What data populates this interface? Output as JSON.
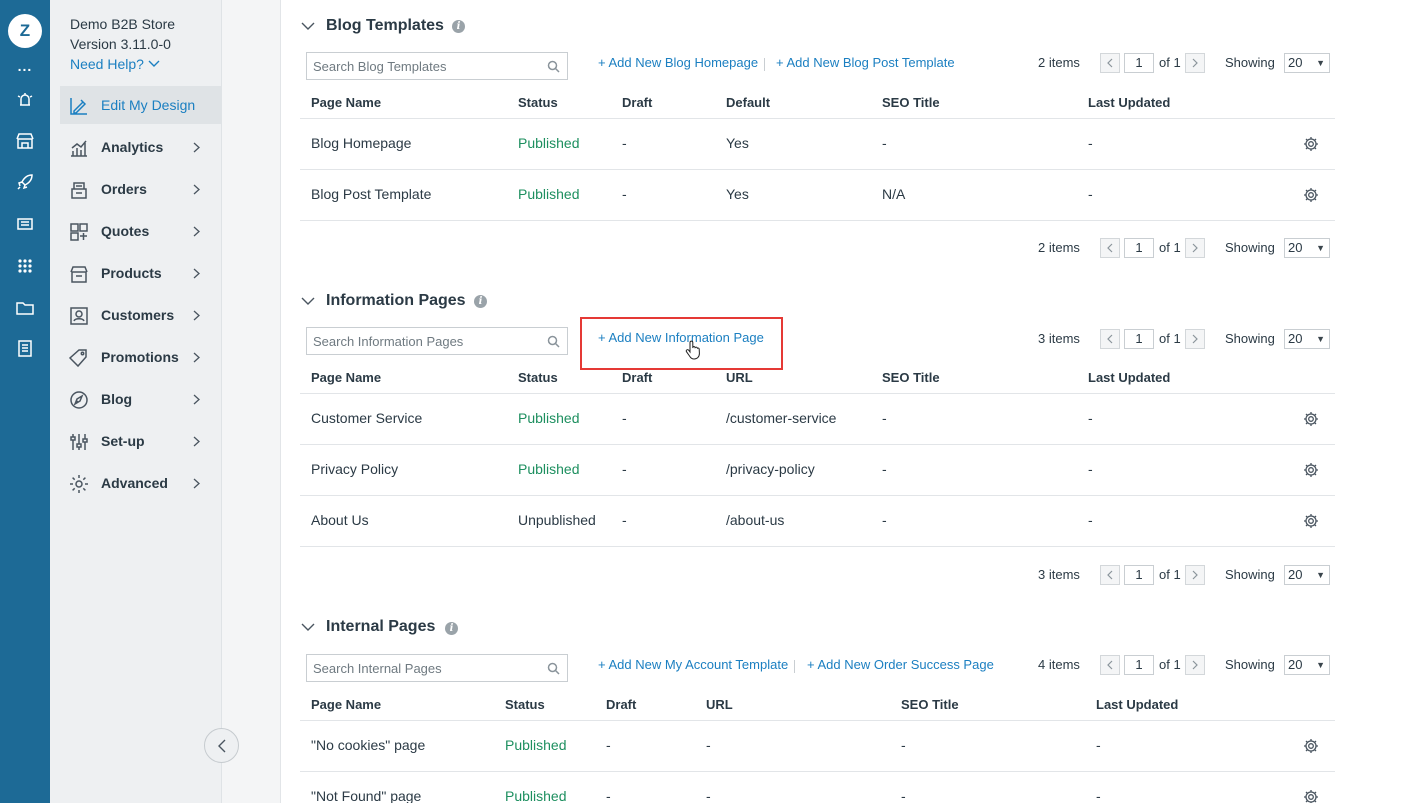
{
  "brand": {
    "logo_letter": "Z",
    "more_dots": "..."
  },
  "rail_icons": [
    "notifications-icon",
    "store-icon",
    "rocket-icon",
    "newsletter-icon",
    "apps-grid-icon",
    "folder-icon",
    "report-icon"
  ],
  "store": {
    "name": "Demo B2B Store",
    "version": "Version 3.11.0-0",
    "help": "Need Help?"
  },
  "nav": [
    {
      "label": "Edit My Design",
      "icon": "design-icon",
      "active": true
    },
    {
      "label": "Analytics",
      "icon": "analytics-icon"
    },
    {
      "label": "Orders",
      "icon": "orders-icon"
    },
    {
      "label": "Quotes",
      "icon": "quotes-icon"
    },
    {
      "label": "Products",
      "icon": "products-icon"
    },
    {
      "label": "Customers",
      "icon": "customers-icon"
    },
    {
      "label": "Promotions",
      "icon": "promotions-icon"
    },
    {
      "label": "Blog",
      "icon": "blog-icon"
    },
    {
      "label": "Set-up",
      "icon": "setup-icon"
    },
    {
      "label": "Advanced",
      "icon": "advanced-icon"
    }
  ],
  "blog": {
    "title": "Blog Templates",
    "search_placeholder": "Search Blog Templates",
    "links": [
      "+ Add New Blog Homepage",
      "+ Add New Blog Post Template"
    ],
    "pagination": {
      "items": "2 items",
      "page": "1",
      "of": "of 1",
      "showing": "Showing",
      "per_page": "20"
    },
    "columns": [
      "Page Name",
      "Status",
      "Draft",
      "Default",
      "SEO Title",
      "Last Updated"
    ],
    "rows": [
      [
        "Blog Homepage",
        "Published",
        "-",
        "Yes",
        "-",
        "-"
      ],
      [
        "Blog Post Template",
        "Published",
        "-",
        "Yes",
        "N/A",
        "-"
      ]
    ]
  },
  "info": {
    "title": "Information Pages",
    "search_placeholder": "Search Information Pages",
    "links": [
      "+ Add New Information Page"
    ],
    "pagination": {
      "items": "3 items",
      "page": "1",
      "of": "of 1",
      "showing": "Showing",
      "per_page": "20"
    },
    "columns": [
      "Page Name",
      "Status",
      "Draft",
      "URL",
      "SEO Title",
      "Last Updated"
    ],
    "rows": [
      [
        "Customer Service",
        "Published",
        "-",
        "/customer-service",
        "-",
        "-"
      ],
      [
        "Privacy Policy",
        "Published",
        "-",
        "/privacy-policy",
        "-",
        "-"
      ],
      [
        "About Us",
        "Unpublished",
        "-",
        "/about-us",
        "-",
        "-"
      ]
    ]
  },
  "internal": {
    "title": "Internal Pages",
    "search_placeholder": "Search Internal Pages",
    "links": [
      "+ Add New My Account Template",
      "+ Add New Order Success Page"
    ],
    "pagination": {
      "items": "4 items",
      "page": "1",
      "of": "of 1",
      "showing": "Showing",
      "per_page": "20"
    },
    "columns": [
      "Page Name",
      "Status",
      "Draft",
      "URL",
      "SEO Title",
      "Last Updated"
    ],
    "rows": [
      [
        "\"No cookies\" page",
        "Published",
        "-",
        "-",
        "-",
        "-"
      ],
      [
        "\"Not Found\" page",
        "Published",
        "-",
        "-",
        "-",
        "-"
      ]
    ]
  },
  "colors": {
    "rail": "#1d6a96",
    "link": "#1b7fc1",
    "published": "#1d8f5f",
    "highlight": "#e53935"
  }
}
